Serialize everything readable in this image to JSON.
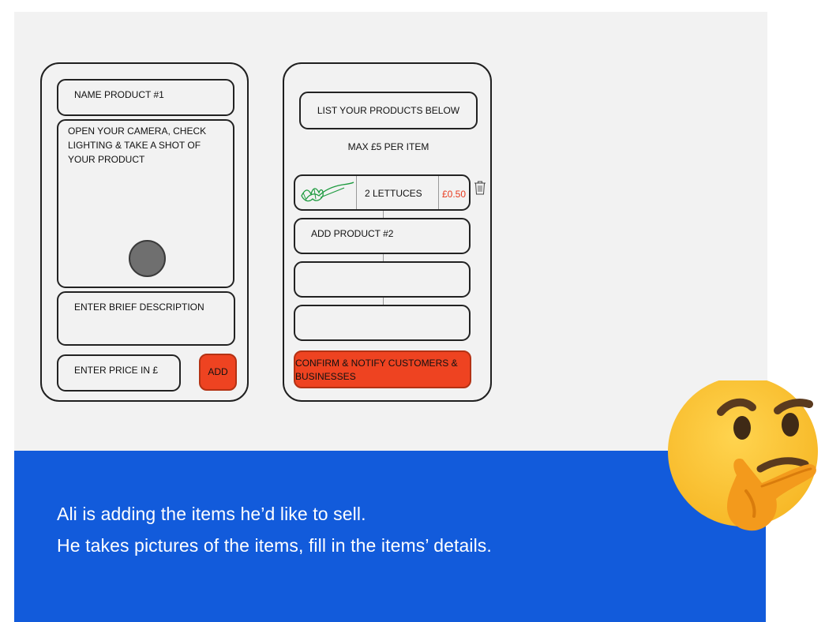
{
  "left_phone": {
    "name_field": "NAME PRODUCT #1",
    "camera_prompt": "OPEN YOUR CAMERA, CHECK LIGHTING & TAKE A SHOT OF YOUR PRODUCT",
    "description_field": "ENTER BRIEF DESCRIPTION",
    "price_field": "ENTER PRICE IN £",
    "add_button": "ADD"
  },
  "right_phone": {
    "header": "LIST YOUR PRODUCTS BELOW",
    "subheader": "MAX £5 PER ITEM",
    "items": [
      {
        "name": "2 LETTUCES",
        "price": "£0.50"
      }
    ],
    "add_product_field": "ADD PRODUCT #2",
    "confirm_button": "CONFIRM & NOTIFY CUSTOMERS & BUSINESSES"
  },
  "caption": {
    "line1": "Ali is adding the items he’d like to sell.",
    "line2": "He takes pictures of the items, fill in the items’ details."
  },
  "colors": {
    "accent_red": "#ee4321",
    "price_red": "#e8391d",
    "band_blue": "#125bdb",
    "emoji_yellow": "#fcc836"
  },
  "icons": [
    "trash-icon",
    "thinking-face-emoji",
    "lettuce-sketch-icon",
    "camera-shutter-icon"
  ]
}
